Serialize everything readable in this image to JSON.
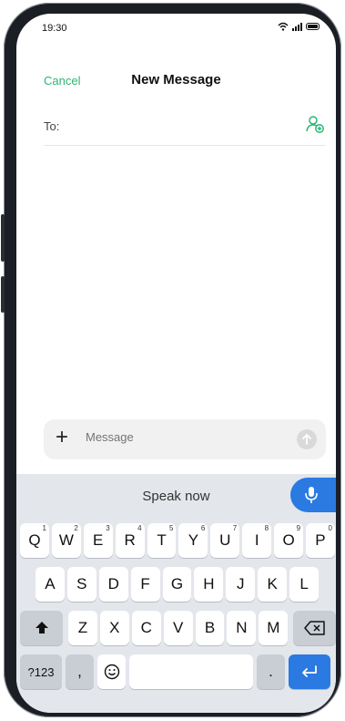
{
  "status_bar": {
    "time": "19:30"
  },
  "header": {
    "cancel_label": "Cancel",
    "title": "New Message"
  },
  "recipient": {
    "label": "To:"
  },
  "composer": {
    "placeholder": "Message",
    "plus_symbol": "+"
  },
  "keyboard": {
    "voice_prompt": "Speak now",
    "rows": [
      [
        {
          "label": "Q",
          "sup": "1"
        },
        {
          "label": "W",
          "sup": "2"
        },
        {
          "label": "E",
          "sup": "3"
        },
        {
          "label": "R",
          "sup": "4"
        },
        {
          "label": "T",
          "sup": "5"
        },
        {
          "label": "Y",
          "sup": "6"
        },
        {
          "label": "U",
          "sup": "7"
        },
        {
          "label": "I",
          "sup": "8"
        },
        {
          "label": "O",
          "sup": "9"
        },
        {
          "label": "P",
          "sup": "0"
        }
      ],
      [
        {
          "label": "A"
        },
        {
          "label": "S"
        },
        {
          "label": "D"
        },
        {
          "label": "F"
        },
        {
          "label": "G"
        },
        {
          "label": "H"
        },
        {
          "label": "J"
        },
        {
          "label": "K"
        },
        {
          "label": "L"
        }
      ],
      [
        {
          "label": "Z"
        },
        {
          "label": "X"
        },
        {
          "label": "C"
        },
        {
          "label": "V"
        },
        {
          "label": "B"
        },
        {
          "label": "N"
        },
        {
          "label": "M"
        }
      ]
    ],
    "symbols_label": "?123",
    "comma_label": ",",
    "period_label": "."
  },
  "colors": {
    "accent_green": "#2bb673",
    "accent_blue": "#2a7ae2"
  },
  "icons": [
    "wifi-icon",
    "signal-icon",
    "battery-icon",
    "add-contact-icon",
    "send-arrow-icon",
    "microphone-icon",
    "shift-icon",
    "backspace-icon",
    "emoji-icon",
    "enter-icon"
  ]
}
